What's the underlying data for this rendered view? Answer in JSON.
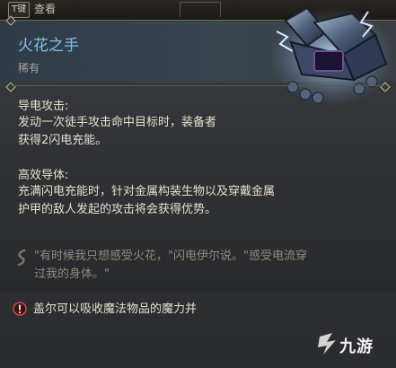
{
  "top_bar": {
    "key_hint": "T键",
    "key_label": "查看"
  },
  "item": {
    "name": "火花之手",
    "rarity": "稀有",
    "icon": "storm-gauntlets-icon"
  },
  "properties": [
    {
      "title": "导电攻击:",
      "lines": [
        "发动一次徒手攻击命中目标时，装备者",
        "获得2闪电充能。"
      ]
    },
    {
      "title": "高效导体:",
      "lines": [
        "充满闪电充能时，针对金属构装生物以及穿戴金属",
        "护甲的敌人发起的攻击将会获得优势。"
      ]
    }
  ],
  "quote": {
    "icon": "quote-swirl-icon",
    "lines": [
      "\"有时候我只想感受火花，\"闪电伊尔说。\"感受电流穿",
      "过我的身体。\""
    ]
  },
  "note": {
    "icon": "alert-icon",
    "text": "盖尔可以吸收魔法物品的魔力并"
  },
  "watermark": {
    "text": "九游"
  },
  "colors": {
    "title": "#7fc0ea",
    "body_text": "#e6dfcf",
    "muted_text": "#a8a296",
    "quote_text": "#8f8a80"
  }
}
